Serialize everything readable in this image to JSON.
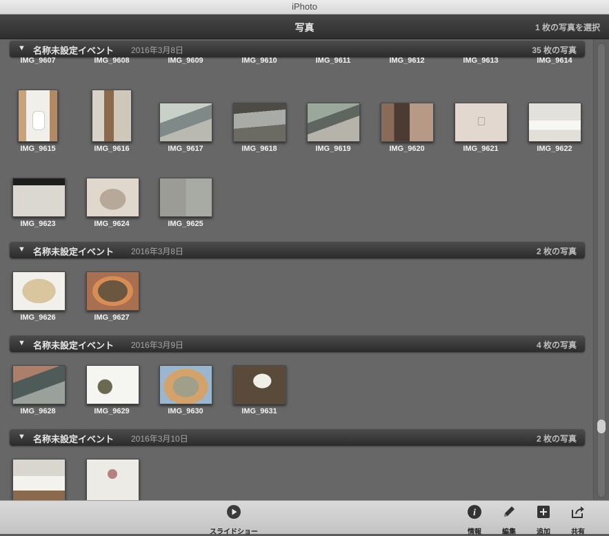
{
  "window": {
    "title": "iPhoto"
  },
  "header": {
    "title": "写真",
    "selection": "1 枚の写真を選択"
  },
  "events": [
    {
      "name": "名称未設定イベント",
      "date": "2016年3月8日",
      "count": "35 枚の写真"
    },
    {
      "name": "名称未設定イベント",
      "date": "2016年3月8日",
      "count": "2 枚の写真"
    },
    {
      "name": "名称未設定イベント",
      "date": "2016年3月9日",
      "count": "4 枚の写真"
    },
    {
      "name": "名称未設定イベント",
      "date": "2016年3月10日",
      "count": "2 枚の写真"
    }
  ],
  "photos": {
    "row0": [
      "IMG_9607",
      "IMG_9608",
      "IMG_9609",
      "IMG_9610",
      "IMG_9611",
      "IMG_9612",
      "IMG_9613",
      "IMG_9614"
    ],
    "row1": [
      "IMG_9615",
      "IMG_9616",
      "IMG_9617",
      "IMG_9618",
      "IMG_9619",
      "IMG_9620",
      "IMG_9621",
      "IMG_9622"
    ],
    "row2": [
      "IMG_9623",
      "IMG_9624",
      "IMG_9625"
    ],
    "row3": [
      "IMG_9626",
      "IMG_9627"
    ],
    "row4": [
      "IMG_9628",
      "IMG_9629",
      "IMG_9630",
      "IMG_9631"
    ]
  },
  "toolbar": {
    "slideshow": "スライドショー",
    "info": "情報",
    "edit": "編集",
    "add": "追加",
    "share": "共有"
  },
  "icons": {
    "play": "play-circle-icon",
    "info": "info-icon",
    "edit": "pencil-icon",
    "add": "plus-icon",
    "share": "share-icon"
  },
  "colors": {
    "accent": "#2f2f2f",
    "content_bg": "#676767",
    "toolbar_bg": "#cfcfcf"
  }
}
